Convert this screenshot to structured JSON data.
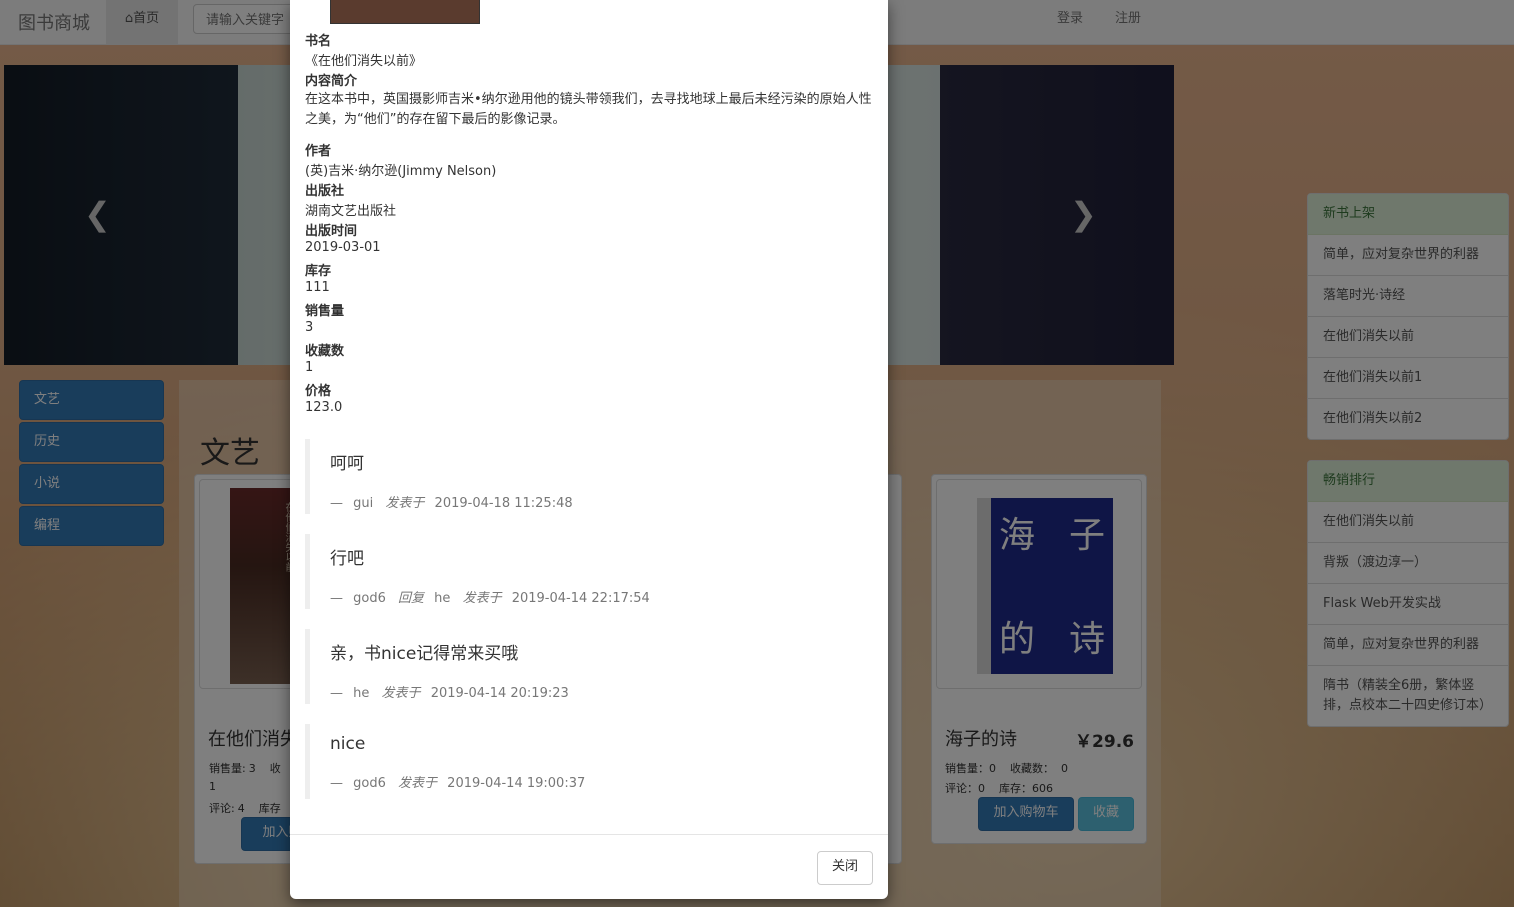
{
  "navbar": {
    "brand": "图书商城",
    "home_label": "首页",
    "search_placeholder": "请输入关键字",
    "login": "登录",
    "register": "注册"
  },
  "categories": [
    "文艺",
    "历史",
    "小说",
    "编程"
  ],
  "section_title": "文艺",
  "cards": {
    "left": {
      "title": "在他们消失",
      "cover_title": "在他们消失以前",
      "sales_label": "销售量:",
      "sales": "3",
      "fav_label": "收",
      "fav_overflow": "1",
      "comments_label": "评论:",
      "comments": "4",
      "stock_label": "库存",
      "cart_btn": "加入购"
    },
    "right": {
      "title": "海子的诗",
      "price": "￥29.6",
      "sales_line": "销售量：0    收藏数：  0",
      "comments_line": "评论：0    库存：606",
      "cart_btn": "加入购物车",
      "fav_btn": "收藏",
      "cover_chars": [
        "海",
        "子",
        "的",
        "诗"
      ]
    }
  },
  "new_books": {
    "title": "新书上架",
    "items": [
      "简单，应对复杂世界的利器",
      "落笔时光·诗经",
      "在他们消失以前",
      "在他们消失以前1",
      "在他们消失以前2"
    ]
  },
  "best_sellers": {
    "title": "畅销排行",
    "items": [
      "在他们消失以前",
      "背叛（渡边淳一）",
      "Flask Web开发实战",
      "简单，应对复杂世界的利器",
      "隋书（精装全6册，繁体竖排，点校本二十四史修订本）"
    ]
  },
  "modal": {
    "fields": [
      {
        "label": "书名",
        "value": "《在他们消失以前》"
      },
      {
        "label": "内容简介",
        "value": "在这本书中，英国摄影师吉米•纳尔逊用他的镜头带领我们，去寻找地球上最后未经污染的原始人性之美，为“他们”的存在留下最后的影像记录。"
      },
      {
        "label": "作者",
        "value": "(英)吉米·纳尔逊(Jimmy Nelson)"
      },
      {
        "label": "出版社",
        "value": "湖南文艺出版社"
      },
      {
        "label": "出版时间",
        "value": "2019-03-01"
      },
      {
        "label": "库存",
        "value": "111"
      },
      {
        "label": "销售量",
        "value": "3"
      },
      {
        "label": "收藏数",
        "value": "1"
      },
      {
        "label": "价格",
        "value": "123.0"
      }
    ],
    "comments": [
      {
        "text": "呵呵",
        "dash": "—",
        "user": "gui",
        "reply_label": "",
        "reply_to": "",
        "posted_label": "发表于",
        "time": "2019-04-18 11:25:48"
      },
      {
        "text": "行吧",
        "dash": "—",
        "user": "god6",
        "reply_label": "回复",
        "reply_to": "he",
        "posted_label": "发表于",
        "time": "2019-04-14 22:17:54"
      },
      {
        "text": "亲，书nice记得常来买哦",
        "dash": "—",
        "user": "he",
        "reply_label": "",
        "reply_to": "",
        "posted_label": "发表于",
        "time": "2019-04-14 20:19:23"
      },
      {
        "text": "nice",
        "dash": "—",
        "user": "god6",
        "reply_label": "",
        "reply_to": "",
        "posted_label": "发表于",
        "time": "2019-04-14 19:00:37"
      }
    ],
    "close_btn": "关闭"
  }
}
